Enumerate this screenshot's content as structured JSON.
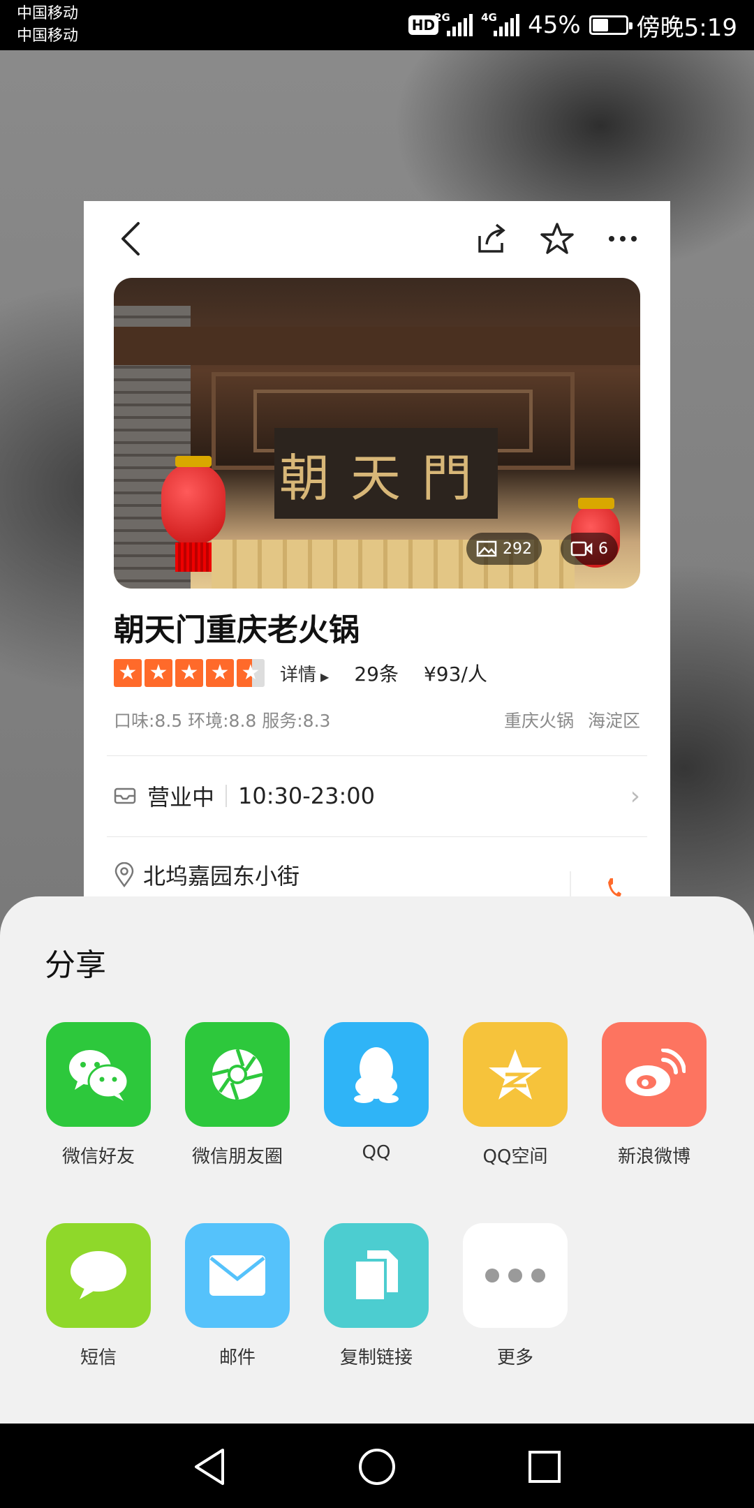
{
  "status_bar": {
    "carrier1": "中国移动",
    "carrier2": "中国移动",
    "hd": "HD",
    "net1": "2G",
    "net2": "4G",
    "battery": "45%",
    "time": "傍晚5:19"
  },
  "shop": {
    "photo_count": "292",
    "video_count": "6",
    "name": "朝天门重庆老火锅",
    "sign_text": "朝天門",
    "rating_stars": 4.5,
    "detail_label": "详情",
    "review_count": "29条",
    "price": "¥93/人",
    "scores": "口味:8.5 环境:8.8 服务:8.3",
    "category": "重庆火锅",
    "district": "海淀区",
    "open_status": "营业中",
    "hours": "10:30-23:00",
    "address": "北坞嘉园东小街"
  },
  "share": {
    "title": "分享",
    "items": [
      {
        "label": "微信好友",
        "icon": "wechat-icon",
        "color": "#2dc83c"
      },
      {
        "label": "微信朋友圈",
        "icon": "moments-icon",
        "color": "#2dc83c"
      },
      {
        "label": "QQ",
        "icon": "qq-icon",
        "color": "#2fb4f7"
      },
      {
        "label": "QQ空间",
        "icon": "qzone-icon",
        "color": "#f6c33b"
      },
      {
        "label": "新浪微博",
        "icon": "weibo-icon",
        "color": "#fd7460"
      },
      {
        "label": "短信",
        "icon": "sms-icon",
        "color": "#8fd82a"
      },
      {
        "label": "邮件",
        "icon": "mail-icon",
        "color": "#55c2fb"
      },
      {
        "label": "复制链接",
        "icon": "copy-link-icon",
        "color": "#4ccdd0"
      },
      {
        "label": "更多",
        "icon": "more-icon",
        "color": "#ffffff"
      }
    ]
  }
}
